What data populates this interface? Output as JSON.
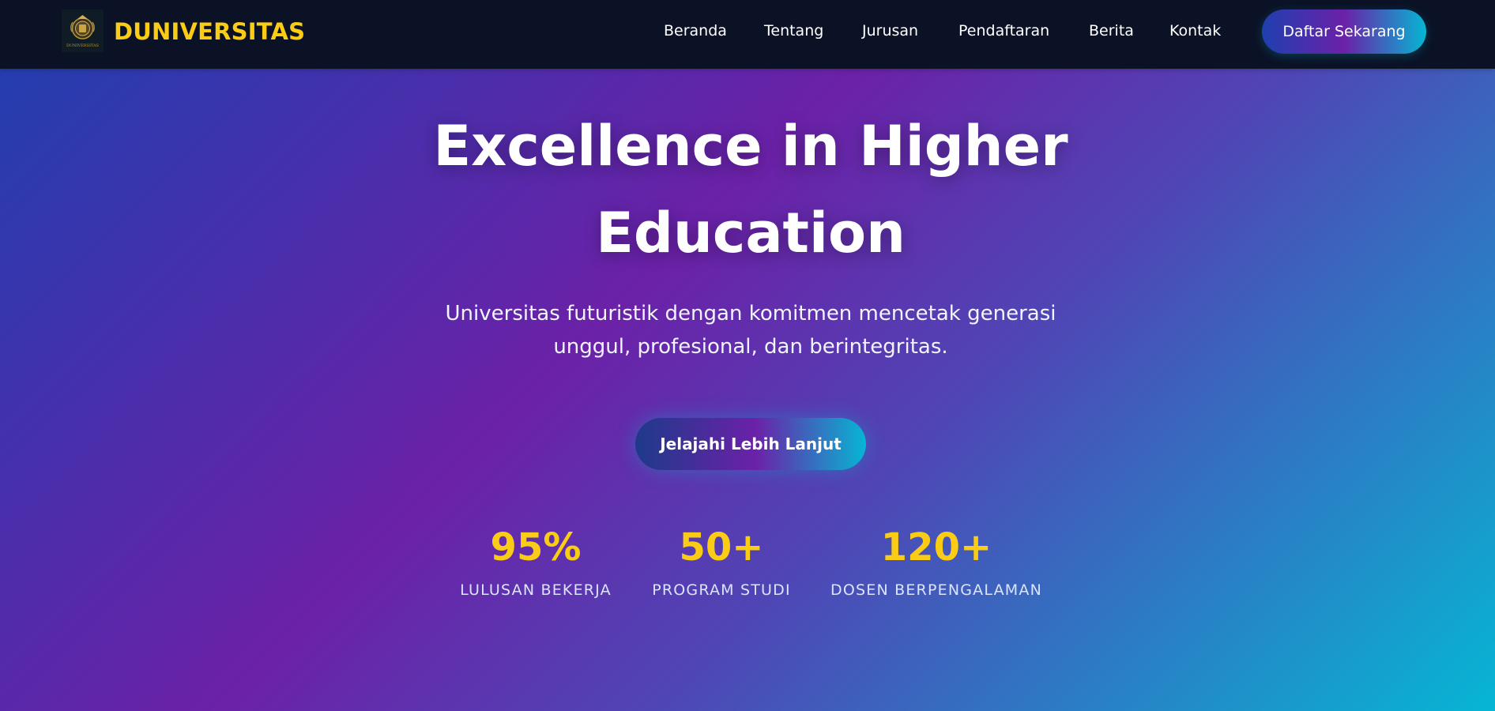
{
  "header": {
    "brand": "DUNIVERSITAS",
    "logo_text": "DUNIVERSITAS",
    "nav": [
      {
        "label": "Beranda"
      },
      {
        "label": "Tentang"
      },
      {
        "label": "Jurusan"
      },
      {
        "label": "Pendaftaran"
      },
      {
        "label": "Berita"
      },
      {
        "label": "Kontak"
      }
    ],
    "cta_label": "Daftar Sekarang"
  },
  "hero": {
    "title_line1": "Excellence in Higher",
    "title_line2": "Education",
    "subtitle_line1": "Universitas futuristik dengan komitmen mencetak generasi",
    "subtitle_line2": "unggul, profesional, dan berintegritas.",
    "cta_label": "Jelajahi Lebih Lanjut"
  },
  "stats": [
    {
      "value": "95%",
      "label": "LULUSAN BEKERJA"
    },
    {
      "value": "50+",
      "label": "PROGRAM STUDI"
    },
    {
      "value": "120+",
      "label": "DOSEN BERPENGALAMAN"
    }
  ],
  "colors": {
    "accent": "#facc15",
    "header_bg": "#0b1226",
    "gradient_start": "#1e40af",
    "gradient_mid": "#6b21a8",
    "gradient_end": "#06b6d4"
  }
}
